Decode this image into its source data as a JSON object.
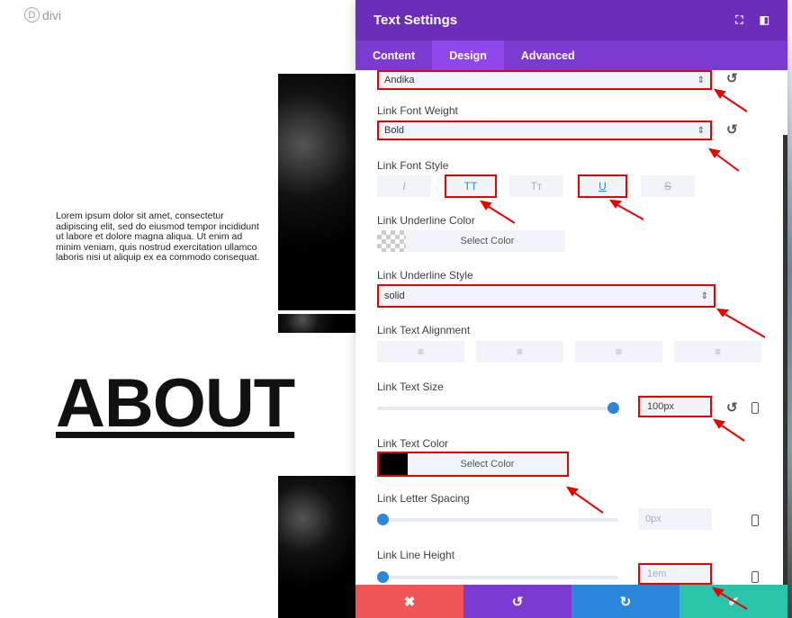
{
  "logo": {
    "letter": "D",
    "text": "divi"
  },
  "page": {
    "lorem": "Lorem ipsum dolor sit amet, consectetur adipiscing elit, sed do eiusmod tempor incididunt ut labore et dolore magna aliqua. Ut enim ad minim veniam, quis nostrud exercitation ullamco laboris nisi ut aliquip ex ea commodo consequat.",
    "heading": "ABOUT"
  },
  "panel": {
    "title": "Text Settings",
    "tabs": [
      {
        "label": "Content"
      },
      {
        "label": "Design"
      },
      {
        "label": "Advanced"
      }
    ],
    "active_tab": "Design"
  },
  "fields": {
    "font": {
      "value": "Andika"
    },
    "weight": {
      "label": "Link Font Weight",
      "value": "Bold"
    },
    "style": {
      "label": "Link Font Style",
      "buttons": [
        "I",
        "TT",
        "Tт",
        "U",
        "S"
      ],
      "active": [
        "TT",
        "U"
      ]
    },
    "underline_color": {
      "label": "Link Underline Color",
      "button": "Select Color"
    },
    "underline_style": {
      "label": "Link Underline Style",
      "value": "solid"
    },
    "alignment": {
      "label": "Link Text Alignment"
    },
    "text_size": {
      "label": "Link Text Size",
      "value": "100px",
      "slider_percent": 100
    },
    "text_color": {
      "label": "Link Text Color",
      "button": "Select Color",
      "swatch": "#000000"
    },
    "letter_spacing": {
      "label": "Link Letter Spacing",
      "value": "0px",
      "slider_percent": 0
    },
    "line_height": {
      "label": "Link Line Height",
      "value": "1em",
      "slider_percent": 0
    }
  },
  "footer": {
    "cancel": "✖",
    "undo": "↺",
    "redo": "↻",
    "save": "✔"
  },
  "colors": {
    "header": "#6c2eb9",
    "tabs": "#7b3ad0",
    "active_tab": "#8e47ea",
    "cancel": "#ef5555",
    "undo": "#7b3ad0",
    "redo": "#2b87da",
    "save": "#29c4a9",
    "highlight": "#ee0000"
  }
}
